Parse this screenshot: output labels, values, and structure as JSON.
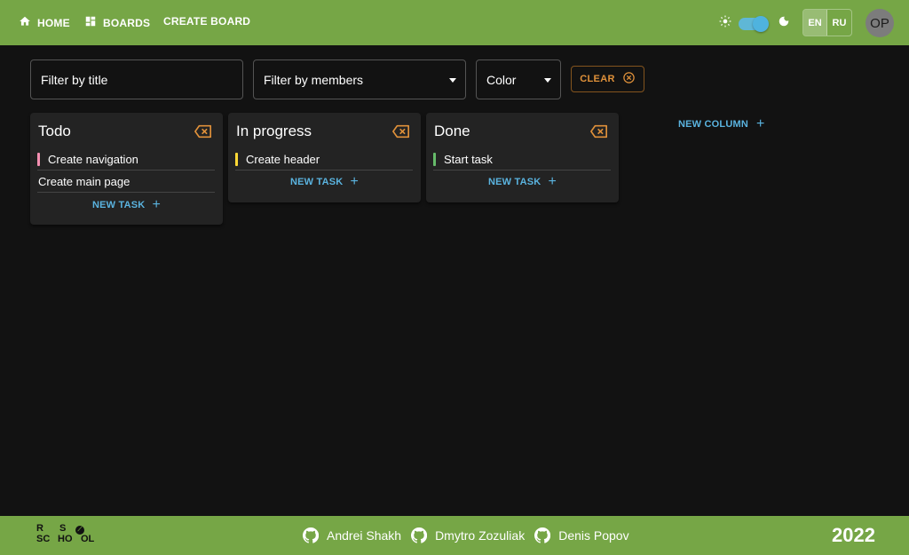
{
  "header": {
    "nav": [
      {
        "label": "HOME",
        "icon": "home-icon"
      },
      {
        "label": "BOARDS",
        "icon": "dashboard-icon"
      },
      {
        "label": "CREATE BOARD"
      }
    ],
    "theme": {
      "light_icon": "sun-icon",
      "dark_icon": "moon-icon",
      "dark_mode": true
    },
    "languages": [
      "EN",
      "RU"
    ],
    "active_language": "EN",
    "avatar_initials": "OP"
  },
  "filters": {
    "title_placeholder": "Filter by title",
    "members_label": "Filter by members",
    "color_label": "Color",
    "clear_label": "CLEAR"
  },
  "columns": [
    {
      "title": "Todo",
      "tasks": [
        {
          "title": "Create navigation",
          "color": "#f48fb1"
        },
        {
          "title": "Create main page",
          "color": null
        }
      ],
      "new_task_label": "NEW TASK"
    },
    {
      "title": "In progress",
      "tasks": [
        {
          "title": "Create header",
          "color": "#fdd835"
        }
      ],
      "new_task_label": "NEW TASK"
    },
    {
      "title": "Done",
      "tasks": [
        {
          "title": "Start task",
          "color": "#66bb6a"
        }
      ],
      "new_task_label": "NEW TASK"
    }
  ],
  "new_column_label": "NEW COLUMN",
  "footer": {
    "authors": [
      "Andrei Shakh",
      "Dmytro Zozuliak",
      "Denis Popov"
    ],
    "year": "2022",
    "logo_text": "RS SCHOOL"
  },
  "colors": {
    "brand_green": "#76a646",
    "accent_blue": "#5ab3df",
    "warning_orange": "#e0913a",
    "background": "#121212",
    "card": "#232323"
  }
}
